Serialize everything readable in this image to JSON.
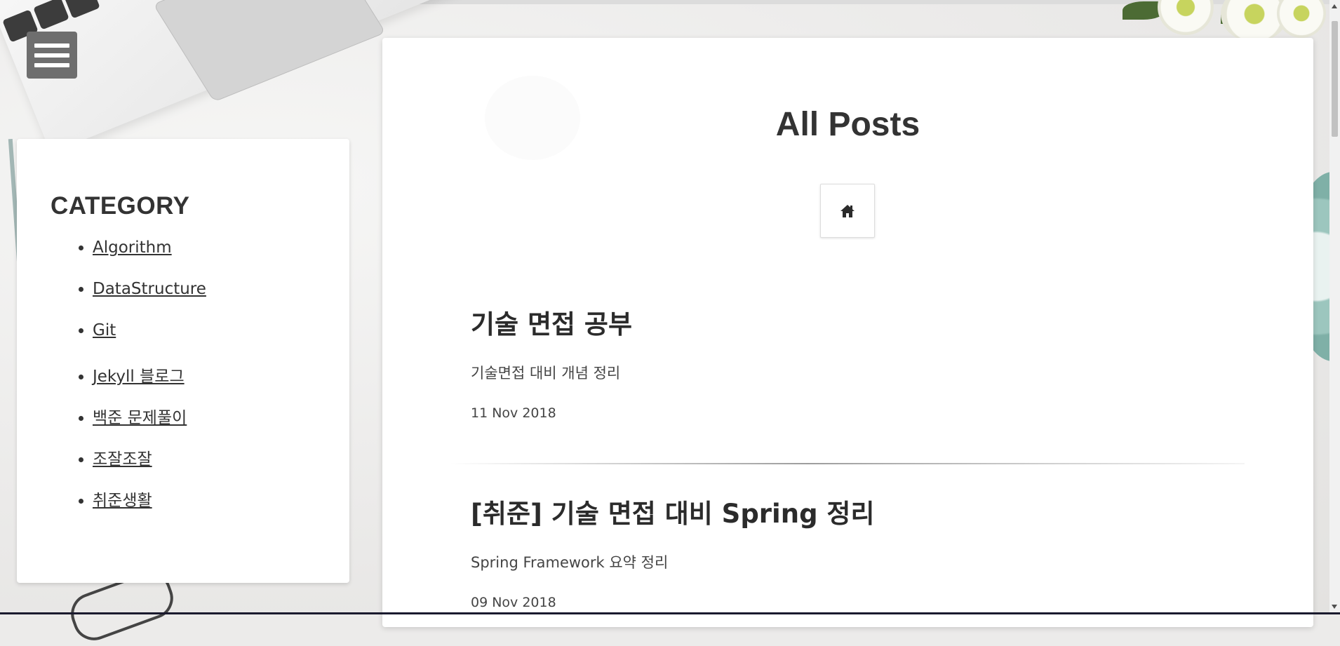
{
  "menu": {
    "icon": "hamburger-menu-icon"
  },
  "sidebar": {
    "title": "CATEGORY",
    "items": [
      {
        "label": "Algorithm"
      },
      {
        "label": "DataStructure"
      },
      {
        "label": "Git"
      },
      {
        "label": "Jekyll 블로그"
      },
      {
        "label": "백준 문제풀이"
      },
      {
        "label": "조잘조잘"
      },
      {
        "label": "취준생활"
      }
    ]
  },
  "main": {
    "title": "All Posts",
    "home_icon": "home-icon",
    "posts": [
      {
        "title": "기술 면접 공부",
        "description": "기술면접 대비 개념 정리",
        "date": "11 Nov 2018"
      },
      {
        "title": "[취준] 기술 면접 대비 Spring 정리",
        "description": "Spring Framework 요약 정리",
        "date": "09 Nov 2018"
      }
    ]
  },
  "colors": {
    "card_background": "#ffffff",
    "text": "#333333",
    "menu_button": "#6e6e6e"
  }
}
